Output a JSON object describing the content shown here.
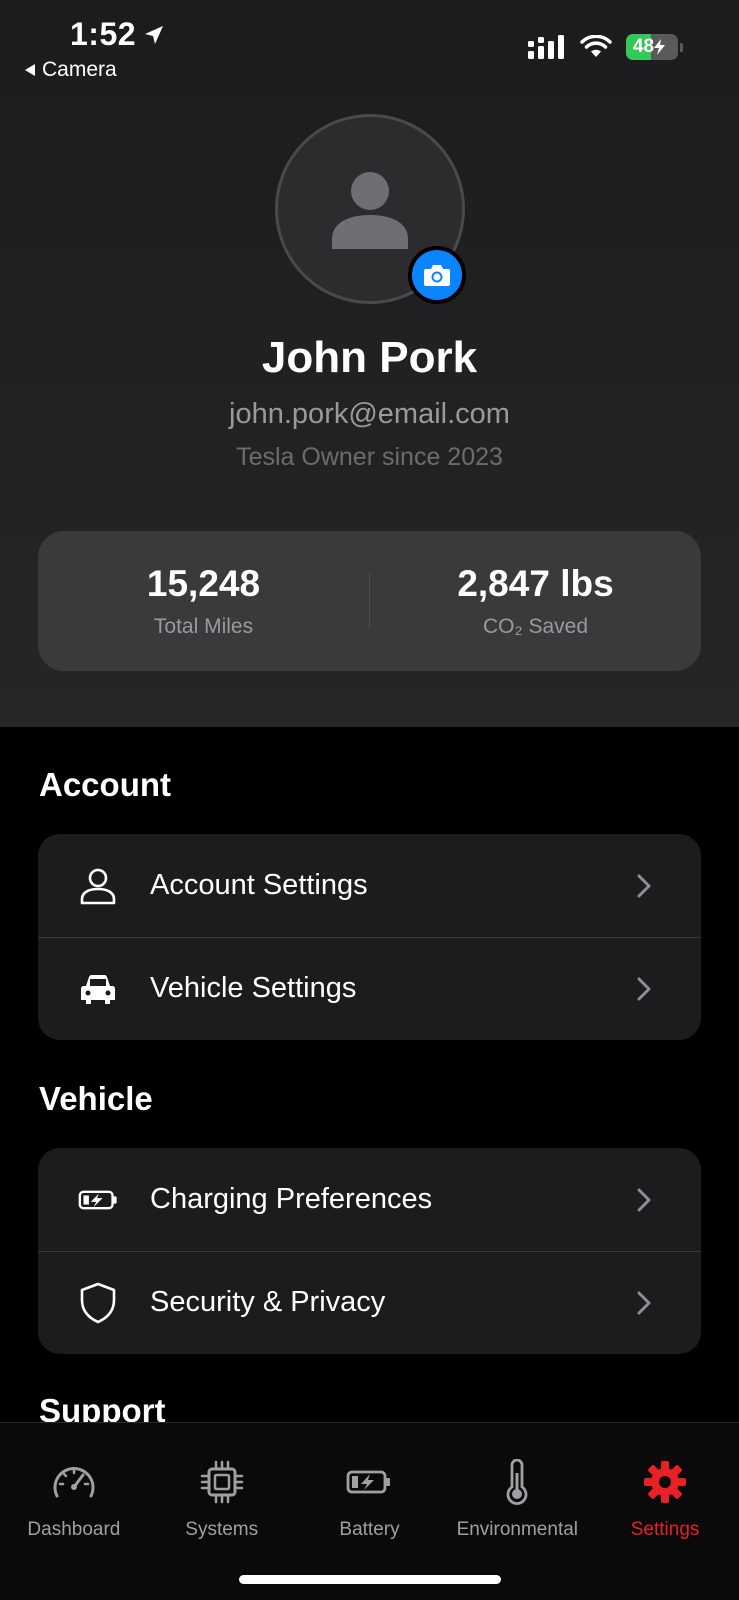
{
  "status_bar": {
    "time": "1:52",
    "back_app": "Camera",
    "battery_level": "48",
    "battery_fraction": 0.48
  },
  "profile": {
    "name": "John Pork",
    "email": "john.pork@email.com",
    "member_since": "Tesla Owner since 2023"
  },
  "stats": [
    {
      "value": "15,248",
      "label": "Total Miles"
    },
    {
      "value": "2,847 lbs",
      "label": "CO₂ Saved"
    }
  ],
  "sections": [
    {
      "title": "Account",
      "items": [
        {
          "label": "Account Settings",
          "icon": "person-icon"
        },
        {
          "label": "Vehicle Settings",
          "icon": "car-icon"
        }
      ]
    },
    {
      "title": "Vehicle",
      "items": [
        {
          "label": "Charging Preferences",
          "icon": "battery-charging-icon"
        },
        {
          "label": "Security & Privacy",
          "icon": "shield-icon"
        }
      ]
    },
    {
      "title": "Support",
      "items": []
    }
  ],
  "tabs": [
    {
      "label": "Dashboard",
      "icon": "gauge-icon",
      "active": false
    },
    {
      "label": "Systems",
      "icon": "chip-icon",
      "active": false
    },
    {
      "label": "Battery",
      "icon": "battery-charging-icon",
      "active": false
    },
    {
      "label": "Environmental",
      "icon": "thermometer-icon",
      "active": false
    },
    {
      "label": "Settings",
      "icon": "gear-icon",
      "active": true
    }
  ],
  "colors": {
    "accent_red": "#e82127",
    "camera_badge_blue": "#0a84ff",
    "battery_green": "#34c759"
  }
}
